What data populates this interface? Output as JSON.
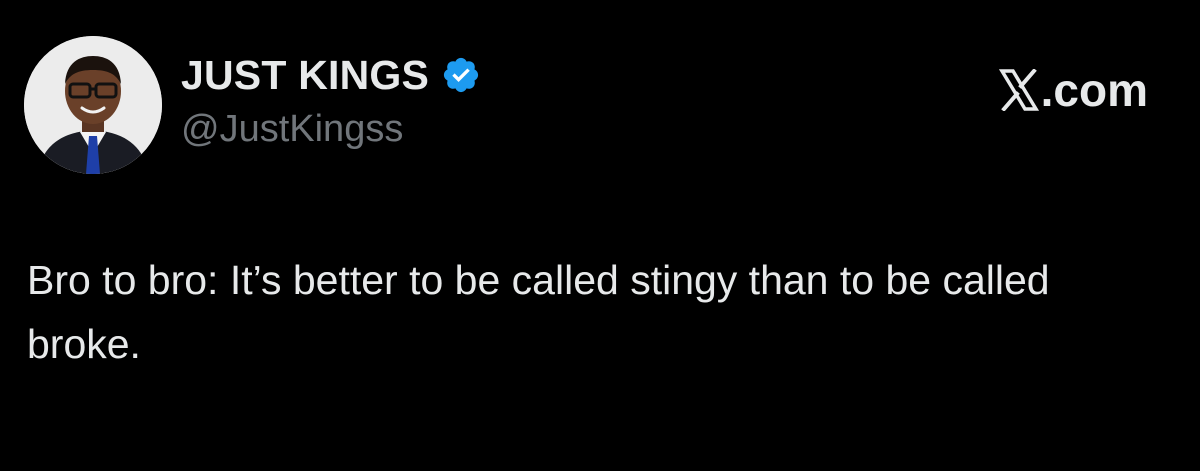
{
  "author": {
    "display_name": "JUST KINGS",
    "handle": "@JustKingss",
    "verified": true
  },
  "brand": {
    "text": ".com",
    "icon": "x-logo-icon"
  },
  "tweet": {
    "text": "Bro to bro: It’s better to be called stingy than to be called broke."
  },
  "colors": {
    "background": "#000000",
    "text_primary": "#e7e9ea",
    "text_secondary": "#71767b",
    "verified_blue": "#1d9bf0"
  },
  "icons": {
    "verified": "verified-badge-icon",
    "avatar": "avatar"
  }
}
